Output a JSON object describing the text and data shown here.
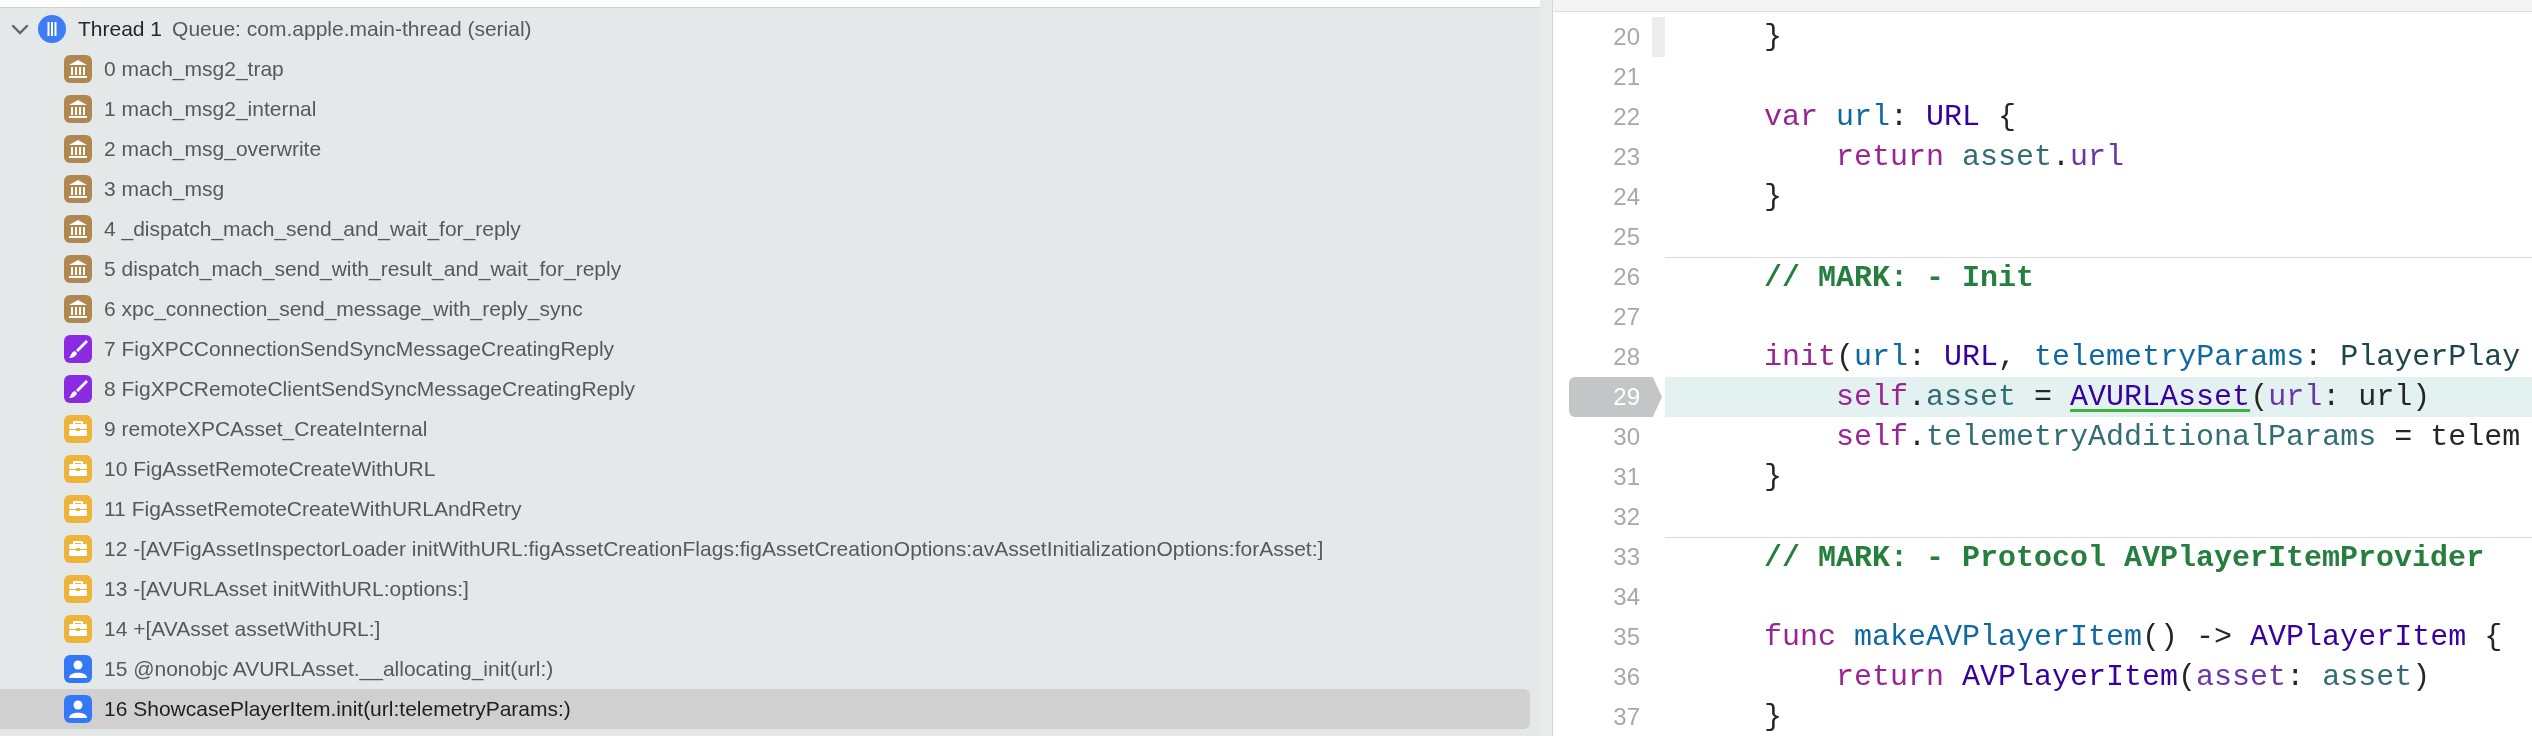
{
  "thread": {
    "title": "Thread 1",
    "queue": "Queue: com.apple.main-thread (serial)",
    "expanded": true
  },
  "frames": [
    {
      "label": "0 mach_msg2_trap",
      "kind": "library",
      "selected": false
    },
    {
      "label": "1 mach_msg2_internal",
      "kind": "library",
      "selected": false
    },
    {
      "label": "2 mach_msg_overwrite",
      "kind": "library",
      "selected": false
    },
    {
      "label": "3 mach_msg",
      "kind": "library",
      "selected": false
    },
    {
      "label": "4 _dispatch_mach_send_and_wait_for_reply",
      "kind": "library",
      "selected": false
    },
    {
      "label": "5 dispatch_mach_send_with_result_and_wait_for_reply",
      "kind": "library",
      "selected": false
    },
    {
      "label": "6 xpc_connection_send_message_with_reply_sync",
      "kind": "library",
      "selected": false
    },
    {
      "label": "7 FigXPCConnectionSendSyncMessageCreatingReply",
      "kind": "graphics",
      "selected": false
    },
    {
      "label": "8 FigXPCRemoteClientSendSyncMessageCreatingReply",
      "kind": "graphics",
      "selected": false
    },
    {
      "label": "9 remoteXPCAsset_CreateInternal",
      "kind": "framework",
      "selected": false
    },
    {
      "label": "10 FigAssetRemoteCreateWithURL",
      "kind": "framework",
      "selected": false
    },
    {
      "label": "11 FigAssetRemoteCreateWithURLAndRetry",
      "kind": "framework",
      "selected": false
    },
    {
      "label": "12 -[AVFigAssetInspectorLoader initWithURL:figAssetCreationFlags:figAssetCreationOptions:avAssetInitializationOptions:forAsset:]",
      "kind": "framework",
      "selected": false
    },
    {
      "label": "13 -[AVURLAsset initWithURL:options:]",
      "kind": "framework",
      "selected": false
    },
    {
      "label": "14 +[AVAsset assetWithURL:]",
      "kind": "framework",
      "selected": false
    },
    {
      "label": "15 @nonobjc AVURLAsset.__allocating_init(url:)",
      "kind": "user",
      "selected": false
    },
    {
      "label": "16 ShowcasePlayerItem.init(url:telemetryParams:)",
      "kind": "user",
      "selected": true
    }
  ],
  "editor": {
    "lines": [
      {
        "number": "20",
        "current": false,
        "tokens": [
          {
            "text": "    }",
            "kind": "plain"
          }
        ]
      },
      {
        "number": "21",
        "current": false
      },
      {
        "number": "22",
        "current": false,
        "tokens": [
          {
            "text": "    var ",
            "kind": "keyword"
          },
          {
            "text": "url",
            "kind": "declaration"
          },
          {
            "text": ": ",
            "kind": "plain"
          },
          {
            "text": "URL",
            "kind": "system-type"
          },
          {
            "text": " {",
            "kind": "plain"
          }
        ]
      },
      {
        "number": "23",
        "current": false,
        "tokens": [
          {
            "text": "        return ",
            "kind": "keyword"
          },
          {
            "text": "asset",
            "kind": "project-member"
          },
          {
            "text": ".",
            "kind": "plain"
          },
          {
            "text": "url",
            "kind": "system-member"
          }
        ]
      },
      {
        "number": "24",
        "current": false,
        "tokens": [
          {
            "text": "    }",
            "kind": "plain"
          }
        ]
      },
      {
        "number": "25",
        "current": false
      },
      {
        "number": "26",
        "current": false,
        "tokens": [
          {
            "text": "    // MARK: - Init",
            "kind": "mark"
          }
        ]
      },
      {
        "number": "27",
        "current": false
      },
      {
        "number": "28",
        "current": false,
        "tokens": [
          {
            "text": "    init",
            "kind": "keyword"
          },
          {
            "text": "(",
            "kind": "plain"
          },
          {
            "text": "url",
            "kind": "declaration"
          },
          {
            "text": ": ",
            "kind": "plain"
          },
          {
            "text": "URL",
            "kind": "system-type"
          },
          {
            "text": ", ",
            "kind": "plain"
          },
          {
            "text": "telemetryParams",
            "kind": "declaration"
          },
          {
            "text": ": ",
            "kind": "plain"
          },
          {
            "text": "PlayerPlay",
            "kind": "project-type"
          }
        ]
      },
      {
        "number": "29",
        "current": true,
        "tokens": [
          {
            "text": "        self",
            "kind": "keyword"
          },
          {
            "text": ".",
            "kind": "plain"
          },
          {
            "text": "asset",
            "kind": "project-member"
          },
          {
            "text": " = ",
            "kind": "plain"
          },
          {
            "text": "AVURLAsset",
            "kind": "system-type",
            "underline": true
          },
          {
            "text": "(",
            "kind": "plain"
          },
          {
            "text": "url",
            "kind": "system-member"
          },
          {
            "text": ": url)",
            "kind": "plain"
          }
        ]
      },
      {
        "number": "30",
        "current": false,
        "tokens": [
          {
            "text": "        self",
            "kind": "keyword"
          },
          {
            "text": ".",
            "kind": "plain"
          },
          {
            "text": "telemetryAdditionalParams",
            "kind": "project-member"
          },
          {
            "text": " = telem",
            "kind": "plain"
          }
        ]
      },
      {
        "number": "31",
        "current": false,
        "tokens": [
          {
            "text": "    }",
            "kind": "plain"
          }
        ]
      },
      {
        "number": "32",
        "current": false
      },
      {
        "number": "33",
        "current": false,
        "tokens": [
          {
            "text": "    // MARK: - Protocol AVPlayerItemProvider",
            "kind": "mark"
          }
        ]
      },
      {
        "number": "34",
        "current": false
      },
      {
        "number": "35",
        "current": false,
        "tokens": [
          {
            "text": "    func ",
            "kind": "keyword"
          },
          {
            "text": "makeAVPlayerItem",
            "kind": "declaration"
          },
          {
            "text": "() -> ",
            "kind": "plain"
          },
          {
            "text": "AVPlayerItem",
            "kind": "system-type"
          },
          {
            "text": " {",
            "kind": "plain"
          }
        ]
      },
      {
        "number": "36",
        "current": false,
        "tokens": [
          {
            "text": "        return ",
            "kind": "keyword"
          },
          {
            "text": "AVPlayerItem",
            "kind": "system-type"
          },
          {
            "text": "(",
            "kind": "plain"
          },
          {
            "text": "asset",
            "kind": "system-member"
          },
          {
            "text": ": ",
            "kind": "plain"
          },
          {
            "text": "asset",
            "kind": "project-member"
          },
          {
            "text": ")",
            "kind": "plain"
          }
        ]
      },
      {
        "number": "37",
        "current": false,
        "tokens": [
          {
            "text": "    }",
            "kind": "plain"
          }
        ]
      }
    ]
  }
}
